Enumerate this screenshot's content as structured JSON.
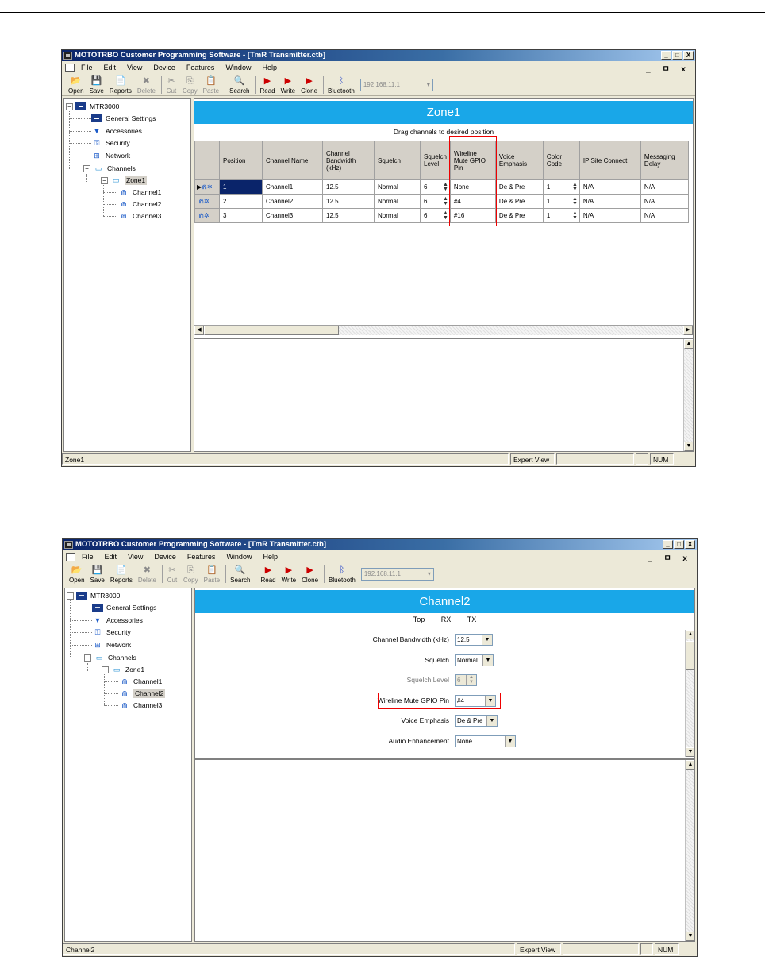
{
  "app": {
    "title": "MOTOTRBO Customer Programming Software - [TmR Transmitter.ctb]",
    "window_controls": [
      "_",
      "□",
      "X"
    ],
    "mdi_controls": "_ ㅁ x",
    "menus": [
      "File",
      "Edit",
      "View",
      "Device",
      "Features",
      "Window",
      "Help"
    ],
    "toolbar": [
      "Open",
      "Save",
      "Reports",
      "Delete",
      "Cut",
      "Copy",
      "Paste",
      "Search",
      "Read",
      "Write",
      "Clone",
      "Bluetooth"
    ],
    "ip_address": "192.168.11.1"
  },
  "tree": {
    "root": "MTR3000",
    "items": [
      "General Settings",
      "Accessories",
      "Security",
      "Network",
      "Channels"
    ],
    "zone": "Zone1",
    "channels": [
      "Channel1",
      "Channel2",
      "Channel3"
    ]
  },
  "window1": {
    "banner": "Zone1",
    "hint": "Drag channels to desired position",
    "columns": [
      "Position",
      "Channel Name",
      "Channel Bandwidth (kHz)",
      "Squelch",
      "Squelch Level",
      "Wireline Mute GPIO Pin",
      "Voice Emphasis",
      "Color Code",
      "IP Site Connect",
      "Messaging Delay"
    ],
    "rows": [
      {
        "position": "1",
        "name": "Channel1",
        "bandwidth": "12.5",
        "squelch": "Normal",
        "level": "6",
        "gpio": "None",
        "emphasis": "De & Pre",
        "color": "1",
        "ipsc": "N/A",
        "delay": "N/A"
      },
      {
        "position": "2",
        "name": "Channel2",
        "bandwidth": "12.5",
        "squelch": "Normal",
        "level": "6",
        "gpio": "#4",
        "emphasis": "De & Pre",
        "color": "1",
        "ipsc": "N/A",
        "delay": "N/A"
      },
      {
        "position": "3",
        "name": "Channel3",
        "bandwidth": "12.5",
        "squelch": "Normal",
        "level": "6",
        "gpio": "#16",
        "emphasis": "De & Pre",
        "color": "1",
        "ipsc": "N/A",
        "delay": "N/A"
      }
    ],
    "status": {
      "left": "Zone1",
      "view": "Expert View",
      "num": "NUM"
    }
  },
  "window2": {
    "banner": "Channel2",
    "links": [
      "Top",
      "RX",
      "TX"
    ],
    "fields": [
      {
        "label": "Channel Bandwidth (kHz)",
        "value": "12.5"
      },
      {
        "label": "Squelch",
        "value": "Normal"
      },
      {
        "label": "Squelch Level",
        "value": "6"
      },
      {
        "label": "Wireline Mute GPIO Pin",
        "value": "#4"
      },
      {
        "label": "Voice Emphasis",
        "value": "De & Pre"
      },
      {
        "label": "Audio Enhancement",
        "value": "None"
      }
    ],
    "status": {
      "left": "Channel2",
      "view": "Expert View",
      "num": "NUM"
    }
  },
  "colors": {
    "banner": "#19a7e8",
    "highlight": "#e00000",
    "title_start": "#0a246a"
  }
}
